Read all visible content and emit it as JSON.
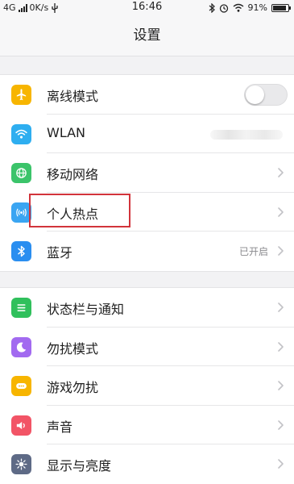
{
  "status_bar": {
    "network": "4G",
    "speed": "0K/s",
    "time": "16:46",
    "battery": "91%",
    "battery_level": 0.91
  },
  "nav": {
    "title": "设置"
  },
  "groups": [
    [
      {
        "key": "airplane",
        "label": "离线模式",
        "icon": "airplane-icon",
        "color": "#f7b500",
        "accessory": "toggle",
        "toggle_on": false
      },
      {
        "key": "wlan",
        "label": "WLAN",
        "icon": "wifi-icon",
        "color": "#2eaef0",
        "accessory": "blurred"
      },
      {
        "key": "mobile",
        "label": "移动网络",
        "icon": "globe-icon",
        "color": "#3bc46a",
        "accessory": "chevron"
      },
      {
        "key": "hotspot",
        "label": "个人热点",
        "icon": "hotspot-icon",
        "color": "#3aa5f2",
        "accessory": "chevron"
      },
      {
        "key": "bluetooth",
        "label": "蓝牙",
        "icon": "bluetooth-icon",
        "color": "#2a8ef0",
        "accessory": "chevron",
        "value": "已开启"
      }
    ],
    [
      {
        "key": "notifications",
        "label": "状态栏与通知",
        "icon": "list-icon",
        "color": "#30c05c",
        "accessory": "chevron"
      },
      {
        "key": "dnd",
        "label": "勿扰模式",
        "icon": "moon-icon",
        "color": "#a26af0",
        "accessory": "chevron"
      },
      {
        "key": "game-dnd",
        "label": "游戏勿扰",
        "icon": "gamepad-icon",
        "color": "#f7b500",
        "accessory": "chevron"
      },
      {
        "key": "sound",
        "label": "声音",
        "icon": "speaker-icon",
        "color": "#f25466",
        "accessory": "chevron"
      },
      {
        "key": "display",
        "label": "显示与亮度",
        "icon": "sun-icon",
        "color": "#5e6a86",
        "accessory": "chevron"
      }
    ]
  ],
  "highlight_target": "hotspot"
}
